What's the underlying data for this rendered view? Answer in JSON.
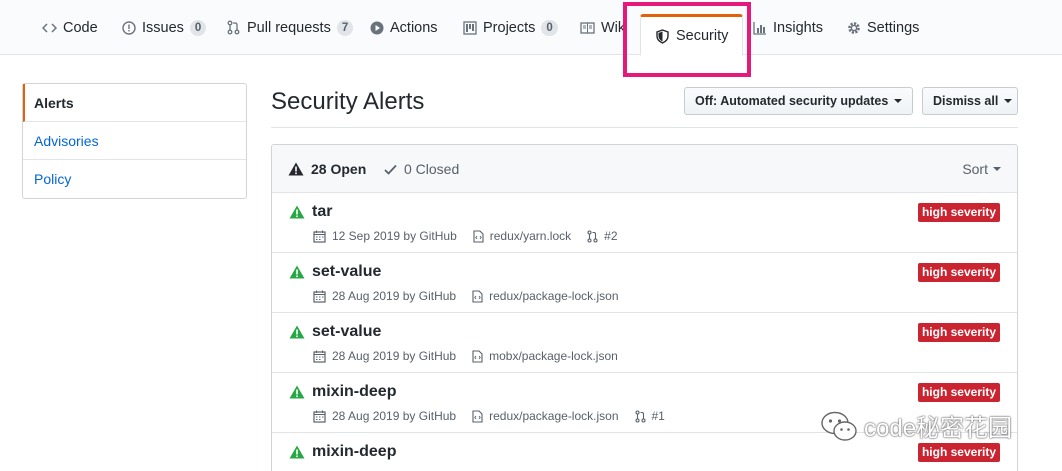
{
  "tabs": [
    {
      "label": "Code",
      "icon": "code-icon"
    },
    {
      "label": "Issues",
      "count": "0",
      "icon": "issue-icon"
    },
    {
      "label": "Pull requests",
      "count": "7",
      "icon": "pull-request-icon"
    },
    {
      "label": "Actions",
      "icon": "play-icon"
    },
    {
      "label": "Projects",
      "count": "0",
      "icon": "project-icon"
    },
    {
      "label": "Wiki",
      "icon": "book-icon"
    },
    {
      "label": "Security",
      "icon": "shield-icon"
    },
    {
      "label": "Insights",
      "icon": "graph-icon"
    },
    {
      "label": "Settings",
      "icon": "gear-icon"
    }
  ],
  "sidebar": {
    "items": [
      {
        "label": "Alerts"
      },
      {
        "label": "Advisories"
      },
      {
        "label": "Policy"
      }
    ]
  },
  "header": {
    "title": "Security Alerts",
    "automated_updates_label": "Off: Automated security updates",
    "dismiss_all_label": "Dismiss all"
  },
  "list": {
    "open_label": "28 Open",
    "closed_label": "0 Closed",
    "sort_label": "Sort",
    "alerts": [
      {
        "name": "tar",
        "date": "12 Sep 2019 by GitHub",
        "file": "redux/yarn.lock",
        "pr": "#2",
        "severity": "high severity"
      },
      {
        "name": "set-value",
        "date": "28 Aug 2019 by GitHub",
        "file": "redux/package-lock.json",
        "pr": "",
        "severity": "high severity"
      },
      {
        "name": "set-value",
        "date": "28 Aug 2019 by GitHub",
        "file": "mobx/package-lock.json",
        "pr": "",
        "severity": "high severity"
      },
      {
        "name": "mixin-deep",
        "date": "28 Aug 2019 by GitHub",
        "file": "redux/package-lock.json",
        "pr": "#1",
        "severity": "high severity"
      },
      {
        "name": "mixin-deep",
        "date": "",
        "file": "",
        "pr": "",
        "severity": "high severity"
      }
    ]
  },
  "watermark": {
    "text": "code秘密花园"
  },
  "colors": {
    "accent": "#e36209",
    "highlight": "#e5197a",
    "severity": "#cb2431",
    "link": "#0366d6",
    "alert_icon": "#28a745"
  }
}
